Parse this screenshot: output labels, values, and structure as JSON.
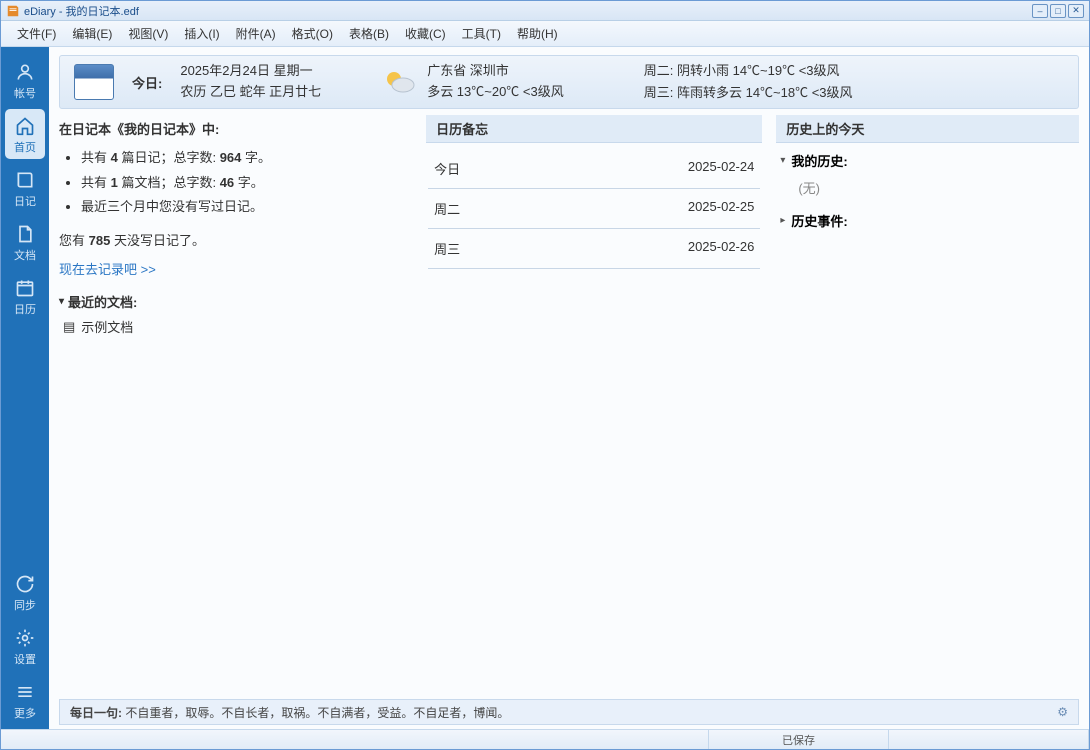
{
  "title": "eDiary - 我的日记本.edf",
  "menu": [
    "文件(F)",
    "编辑(E)",
    "视图(V)",
    "插入(I)",
    "附件(A)",
    "格式(O)",
    "表格(B)",
    "收藏(C)",
    "工具(T)",
    "帮助(H)"
  ],
  "sidebar": {
    "items": [
      {
        "label": "帐号",
        "icon": "user"
      },
      {
        "label": "首页",
        "icon": "home"
      },
      {
        "label": "日记",
        "icon": "book"
      },
      {
        "label": "文档",
        "icon": "doc"
      },
      {
        "label": "日历",
        "icon": "cal"
      }
    ],
    "bottom": [
      {
        "label": "同步",
        "icon": "sync"
      },
      {
        "label": "设置",
        "icon": "gear"
      },
      {
        "label": "更多",
        "icon": "more"
      }
    ]
  },
  "today": {
    "label": "今日:",
    "date_line1": "2025年2月24日 星期一",
    "date_line2": "农历 乙巳 蛇年 正月廿七",
    "weather_loc": "广东省 深圳市",
    "weather_today": "多云 13℃~20℃ <3级风",
    "forecast1": "周二: 阴转小雨 14℃~19℃ <3级风",
    "forecast2": "周三: 阵雨转多云 14℃~18℃ <3级风"
  },
  "left": {
    "heading": "在日记本《我的日记本》中:",
    "stats": [
      {
        "pre": "共有 ",
        "b1": "4",
        "mid": " 篇日记；总字数: ",
        "b2": "964",
        "suf": " 字。"
      },
      {
        "pre": "共有 ",
        "b1": "1",
        "mid": " 篇文档；总字数: ",
        "b2": "46",
        "suf": " 字。"
      },
      {
        "pre": "最近三个月中您没有写过日记。",
        "b1": "",
        "mid": "",
        "b2": "",
        "suf": ""
      }
    ],
    "note_pre": "您有 ",
    "note_b": "785",
    "note_suf": " 天没写日记了。",
    "golink": "现在去记录吧 >>",
    "recent_head": "最近的文档:",
    "recent_doc": "示例文档"
  },
  "memo": {
    "title": "日历备忘",
    "rows": [
      {
        "day": "今日",
        "date": "2025-02-24"
      },
      {
        "day": "周二",
        "date": "2025-02-25"
      },
      {
        "day": "周三",
        "date": "2025-02-26"
      }
    ]
  },
  "history": {
    "title": "历史上的今天",
    "mine": "我的历史:",
    "none": "(无)",
    "events": "历史事件:"
  },
  "quote": {
    "label": "每日一句:",
    "text": "不自重者，取辱。不自长者，取祸。不自满者，受益。不自足者，博闻。"
  },
  "status": {
    "saved": "已保存"
  }
}
